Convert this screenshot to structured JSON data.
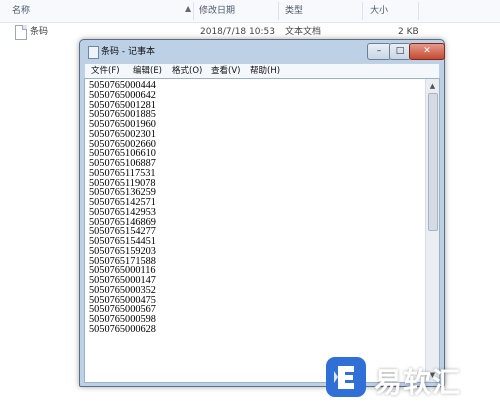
{
  "explorer": {
    "columns": {
      "name": "名称",
      "modified": "修改日期",
      "type": "类型",
      "size": "大小"
    },
    "file": {
      "name": "条码",
      "modified": "2018/7/18 10:53",
      "type": "文本文档",
      "size": "2 KB"
    }
  },
  "notepad": {
    "title": "条码 - 记事本",
    "menu": [
      "文件(F)",
      "编辑(E)",
      "格式(O)",
      "查看(V)",
      "帮助(H)"
    ],
    "lines": [
      "5050765000444",
      "5050765000642",
      "5050765001281",
      "5050765001885",
      "5050765001960",
      "5050765002301",
      "5050765002660",
      "5050765106610",
      "5050765106887",
      "5050765117531",
      "5050765119078",
      "5050765136259",
      "5050765142571",
      "5050765142953",
      "5050765146869",
      "5050765154277",
      "5050765154451",
      "5050765159203",
      "5050765171588",
      "5050765000116",
      "5050765000147",
      "5050765000352",
      "5050765000475",
      "5050765000567",
      "5050765000598",
      "5050765000628"
    ]
  },
  "watermark": {
    "text": "易软汇",
    "color": "#2f6fd6"
  }
}
